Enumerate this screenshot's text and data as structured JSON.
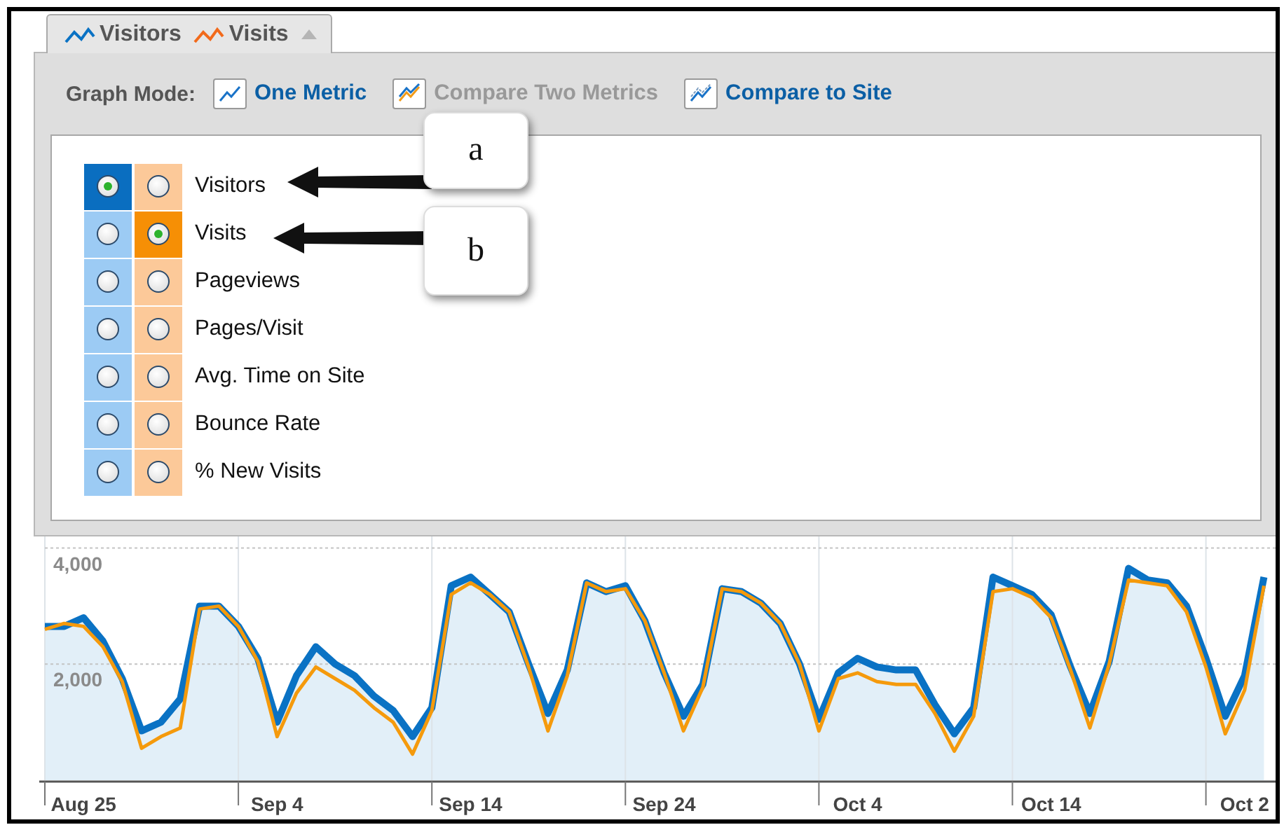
{
  "graph_mode": {
    "label": "Graph Mode:",
    "options": [
      {
        "label": "One Metric",
        "kind": "single",
        "disabled": false
      },
      {
        "label": "Compare Two Metrics",
        "kind": "double",
        "disabled": true
      },
      {
        "label": "Compare to Site",
        "kind": "site",
        "disabled": false
      }
    ]
  },
  "metrics": [
    {
      "label": "Visitors",
      "selected_primary": true,
      "selected_secondary": false
    },
    {
      "label": "Visits",
      "selected_primary": false,
      "selected_secondary": true
    },
    {
      "label": "Pageviews",
      "selected_primary": false,
      "selected_secondary": false
    },
    {
      "label": "Pages/Visit",
      "selected_primary": false,
      "selected_secondary": false
    },
    {
      "label": "Avg. Time on Site",
      "selected_primary": false,
      "selected_secondary": false
    },
    {
      "label": "Bounce Rate",
      "selected_primary": false,
      "selected_secondary": false
    },
    {
      "label": "% New Visits",
      "selected_primary": false,
      "selected_secondary": false
    }
  ],
  "callouts": [
    {
      "label": "a"
    },
    {
      "label": "b"
    }
  ],
  "chart_data": {
    "type": "area",
    "grid": true,
    "categories": [
      null,
      null,
      "Aug 25",
      null,
      null,
      null,
      null,
      null,
      null,
      null,
      null,
      null,
      "Sep 4",
      null,
      null,
      null,
      null,
      null,
      null,
      null,
      null,
      null,
      "Sep 14",
      null,
      null,
      null,
      null,
      null,
      null,
      null,
      null,
      null,
      "Sep 24",
      null,
      null,
      null,
      null,
      null,
      null,
      null,
      null,
      null,
      "Oct 4",
      null,
      null,
      null,
      null,
      null,
      null,
      null,
      null,
      null,
      "Oct 14",
      null,
      null,
      null,
      null,
      null,
      null,
      null,
      null,
      null,
      "Oct 2",
      null
    ],
    "ylim": [
      0,
      4200
    ],
    "yticks": [
      {
        "value": 2000,
        "label": "2,000"
      },
      {
        "value": 4000,
        "label": "4,000"
      }
    ],
    "series": [
      {
        "name": "Visitors",
        "type": "area",
        "color": "#0a72c4",
        "values": [
          2650,
          2650,
          2800,
          2400,
          1750,
          850,
          1000,
          1400,
          3000,
          3000,
          2650,
          2100,
          1000,
          1800,
          2300,
          2000,
          1800,
          1450,
          1200,
          750,
          1250,
          3350,
          3500,
          3200,
          2900,
          2000,
          1150,
          1900,
          3400,
          3250,
          3350,
          2750,
          1850,
          1100,
          1650,
          3300,
          3250,
          3050,
          2700,
          2000,
          1050,
          1850,
          2100,
          1950,
          1900,
          1900,
          1300,
          800,
          1250,
          3500,
          3350,
          3200,
          2850,
          1950,
          1150,
          2050,
          3650,
          3450,
          3400,
          3000,
          2100,
          1100,
          1800,
          3500
        ]
      },
      {
        "name": "Visits",
        "type": "line",
        "color": "#f59a0c",
        "values": [
          2600,
          2700,
          2650,
          2300,
          1700,
          550,
          750,
          900,
          2950,
          3000,
          2650,
          2050,
          750,
          1500,
          1950,
          1750,
          1550,
          1250,
          1000,
          450,
          1200,
          3200,
          3400,
          3200,
          2900,
          1950,
          850,
          1800,
          3400,
          3250,
          3300,
          2750,
          1850,
          850,
          1600,
          3300,
          3250,
          3050,
          2700,
          2000,
          850,
          1750,
          1850,
          1700,
          1650,
          1650,
          1150,
          500,
          1100,
          3250,
          3300,
          3150,
          2800,
          1900,
          900,
          2000,
          3450,
          3400,
          3350,
          2900,
          1950,
          800,
          1550,
          3350
        ]
      }
    ]
  }
}
